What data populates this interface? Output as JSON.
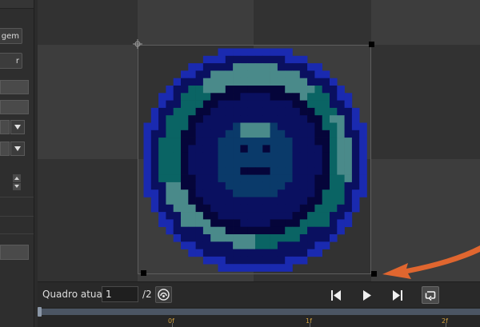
{
  "left_panel": {
    "buttons": [
      {
        "label": "gem"
      },
      {
        "label": "r"
      }
    ]
  },
  "bottom_bar": {
    "frame_label": "Quadro atual:",
    "frame_value": "1",
    "frame_total": "/2"
  },
  "timeline": {
    "ticks": [
      "0f",
      "1f",
      "2f"
    ]
  },
  "icons": {
    "onion_skin": "onion-skin-icon",
    "first_frame": "skip-to-start-icon",
    "play": "play-icon",
    "last_frame": "skip-to-end-icon",
    "loop": "loop-icon"
  },
  "colors": {
    "annotation_arrow": "#e0662f",
    "timeline_tick": "#d0a040",
    "sprite_dark": "#05053a",
    "sprite_navy": "#0a1060",
    "sprite_teal": "#0a6464",
    "sprite_light": "#4a8a8a",
    "sprite_mid": "#0a3a6a",
    "sprite_blue": "#1a2ab0"
  }
}
